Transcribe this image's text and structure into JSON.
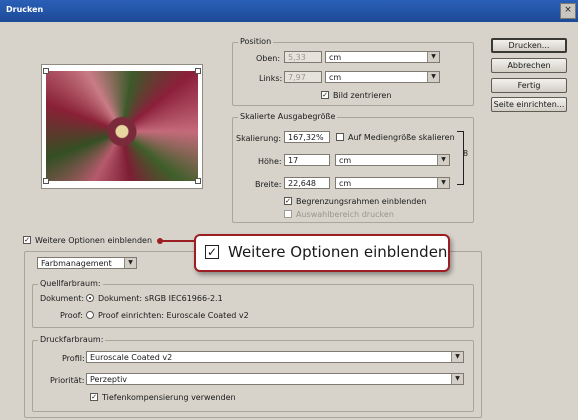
{
  "window": {
    "title": "Drucken",
    "close_glyph": "×"
  },
  "buttons": {
    "print": "Drucken...",
    "cancel": "Abbrechen",
    "done": "Fertig",
    "page_setup": "Seite einrichten..."
  },
  "position": {
    "legend": "Position",
    "top_label": "Oben:",
    "top_value": "5,33",
    "top_unit": "cm",
    "left_label": "Links:",
    "left_value": "7,97",
    "left_unit": "cm",
    "center_label": "Bild zentrieren",
    "center_checked": true
  },
  "scaled": {
    "legend": "Skalierte Ausgabegröße",
    "scale_label": "Skalierung:",
    "scale_value": "167,32%",
    "fit_label": "Auf Mediengröße skalieren",
    "fit_checked": false,
    "height_label": "Höhe:",
    "height_value": "17",
    "height_unit": "cm",
    "width_label": "Breite:",
    "width_value": "22,648",
    "width_unit": "cm",
    "bbox_label": "Begrenzungsrahmen einblenden",
    "bbox_checked": true,
    "selection_label": "Auswahlbereich drucken",
    "selection_checked": false
  },
  "more_options": {
    "label": "Weitere Optionen einblenden",
    "checked": true,
    "mode_select": "Farbmanagement"
  },
  "callout": {
    "label": "Weitere Optionen einblenden"
  },
  "source_space": {
    "legend": "Quellfarbraum:",
    "document_label": "Dokument:",
    "document_option": "Dokument: sRGB IEC61966-2.1",
    "proof_label": "Proof:",
    "proof_option": "Proof einrichten: Euroscale Coated v2"
  },
  "print_space": {
    "legend": "Druckfarbraum:",
    "profile_label": "Profil:",
    "profile_value": "Euroscale Coated v2",
    "priority_label": "Priorität:",
    "priority_value": "Perzeptiv",
    "bpc_label": "Tiefenkompensierung verwenden",
    "bpc_checked": true
  },
  "icons": {
    "checkmark": "✓",
    "arrow_down": "▼",
    "link": "8"
  },
  "colors": {
    "callout_accent": "#9b1f22",
    "titlebar": "#2a5fb8"
  }
}
